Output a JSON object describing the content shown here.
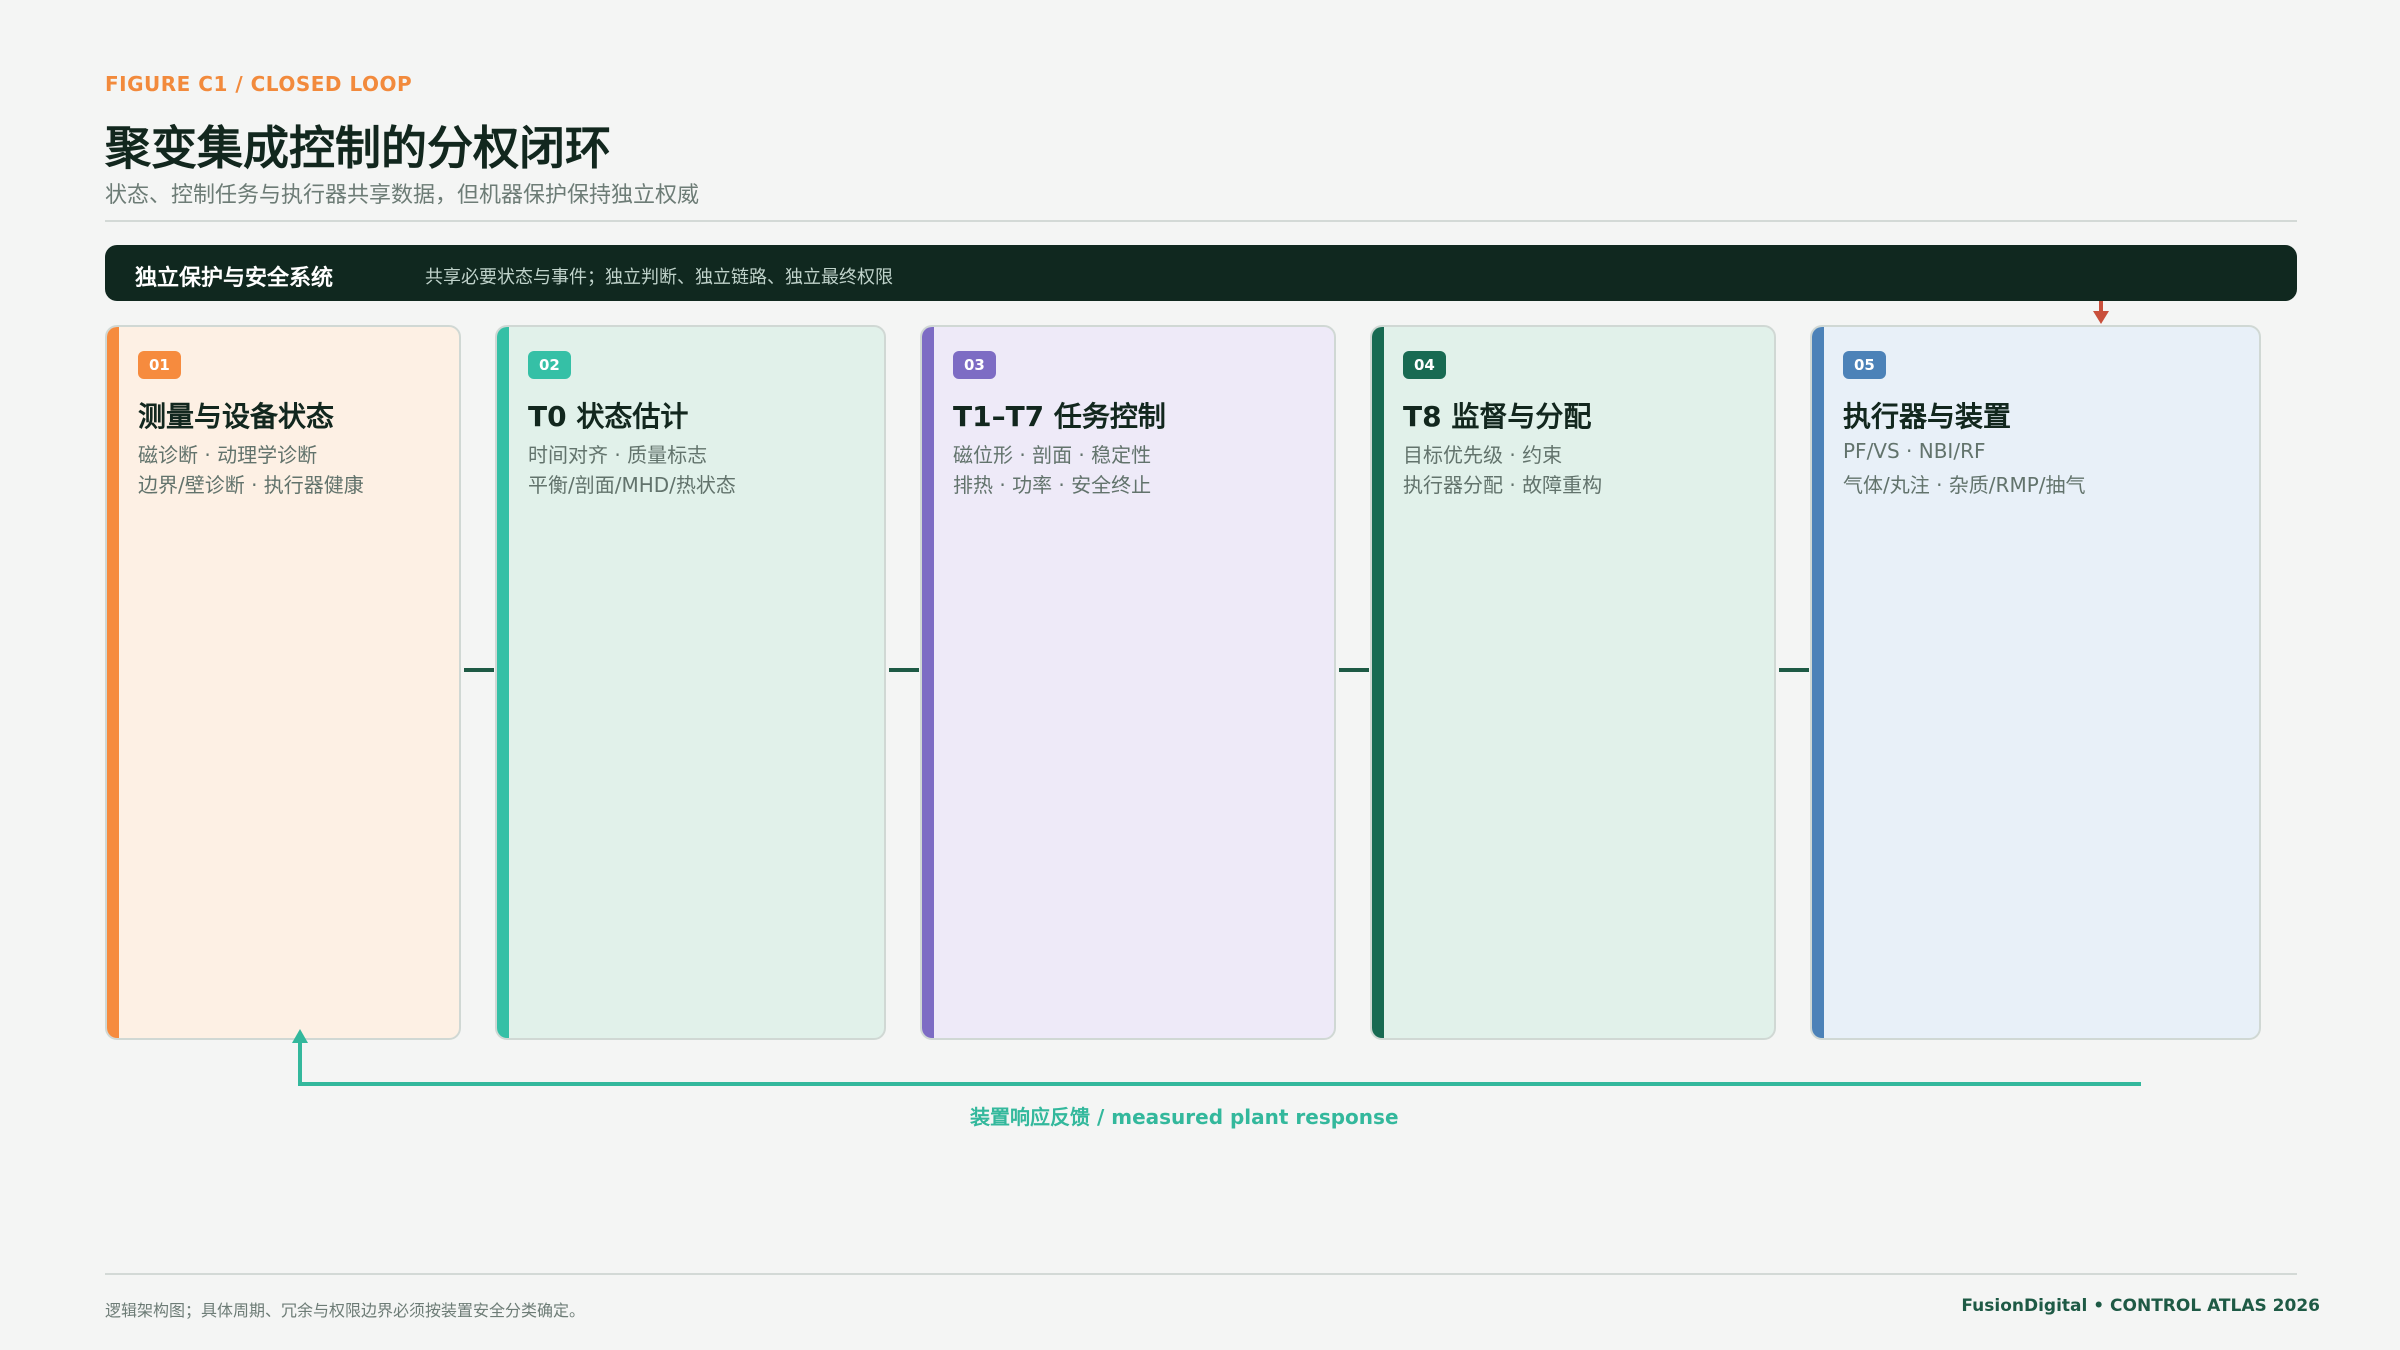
{
  "header": {
    "kicker": "FIGURE C1 / CLOSED LOOP",
    "title": "聚变集成控制的分权闭环",
    "subtitle": "状态、控制任务与执行器共享数据，但机器保护保持独立权威"
  },
  "banner": {
    "title": "独立保护与安全系统",
    "description": "共享必要状态与事件；独立判断、独立链路、独立最终权限"
  },
  "stages": [
    {
      "number": "01",
      "title": "测量与设备状态",
      "line1": "磁诊断 · 动理学诊断",
      "line2": "边界/壁诊断 · 执行器健康",
      "accent": "#f68b3e",
      "fill": "#fdf0e4"
    },
    {
      "number": "02",
      "title": "T0 状态估计",
      "line1": "时间对齐 · 质量标志",
      "line2": "平衡/剖面/MHD/热状态",
      "accent": "#35c0a6",
      "fill": "#e1f1ea"
    },
    {
      "number": "03",
      "title": "T1–T7 任务控制",
      "line1": "磁位形 · 剖面 · 稳定性",
      "line2": "排热 · 功率 · 安全终止",
      "accent": "#7d6cc4",
      "fill": "#eeeaf8"
    },
    {
      "number": "04",
      "title": "T8 监督与分配",
      "line1": "目标优先级 · 约束",
      "line2": "执行器分配 · 故障重构",
      "accent": "#186a52",
      "fill": "#e1f1ea"
    },
    {
      "number": "05",
      "title": "执行器与装置",
      "line1": "PF/VS · NBI/RF",
      "line2": "气体/丸注 · 杂质/RMP/抽气",
      "accent": "#4c82b8",
      "fill": "#e8f0f8"
    }
  ],
  "feedback": {
    "label": "装置响应反馈 / measured plant response"
  },
  "footer": {
    "note": "逻辑架构图；具体周期、冗余与权限边界必须按装置安全分类确定。",
    "brand": "FusionDigital • CONTROL ATLAS 2026"
  },
  "colors": {
    "banner_bg": "#10281f",
    "protection_arrow": "#c9503c",
    "feedback": "#33b89c",
    "connector": "#1e5a45",
    "kicker": "#f28a3c"
  }
}
